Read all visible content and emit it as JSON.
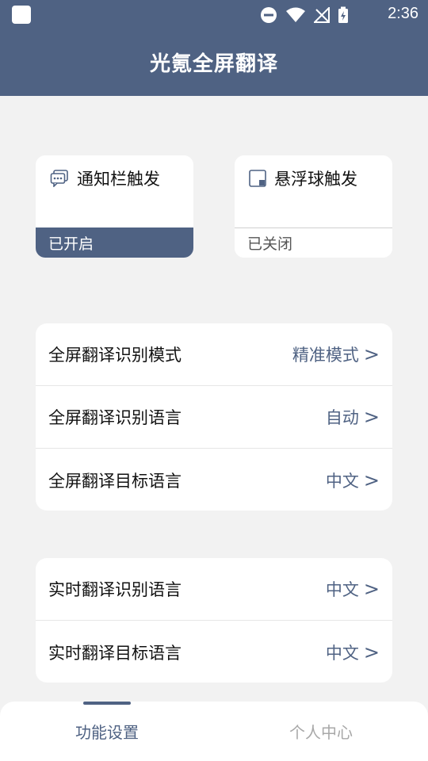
{
  "status_bar": {
    "time": "2:36",
    "icons": [
      "notification-square-icon",
      "do-not-disturb-icon",
      "wifi-icon",
      "no-signal-icon",
      "battery-charging-icon"
    ]
  },
  "header": {
    "title": "光氪全屏翻译"
  },
  "triggers": {
    "notification": {
      "label": "通知栏触发",
      "status": "已开启",
      "icon": "message-icon"
    },
    "floating_ball": {
      "label": "悬浮球触发",
      "status": "已关闭",
      "icon": "floating-window-icon"
    }
  },
  "fullscreen_settings": [
    {
      "label": "全屏翻译识别模式",
      "value": "精准模式",
      "chevron": ">"
    },
    {
      "label": "全屏翻译识别语言",
      "value": "自动",
      "chevron": ">"
    },
    {
      "label": "全屏翻译目标语言",
      "value": "中文",
      "chevron": ">"
    }
  ],
  "realtime_settings": [
    {
      "label": "实时翻译识别语言",
      "value": "中文",
      "chevron": ">"
    },
    {
      "label": "实时翻译目标语言",
      "value": "中文",
      "chevron": ">"
    }
  ],
  "bottom_nav": {
    "tabs": [
      {
        "label": "功能设置",
        "active": true
      },
      {
        "label": "个人中心",
        "active": false
      }
    ]
  },
  "colors": {
    "primary": "#4f6283",
    "background": "#f2f2f2",
    "inactive_tab": "#a8a8a8"
  }
}
